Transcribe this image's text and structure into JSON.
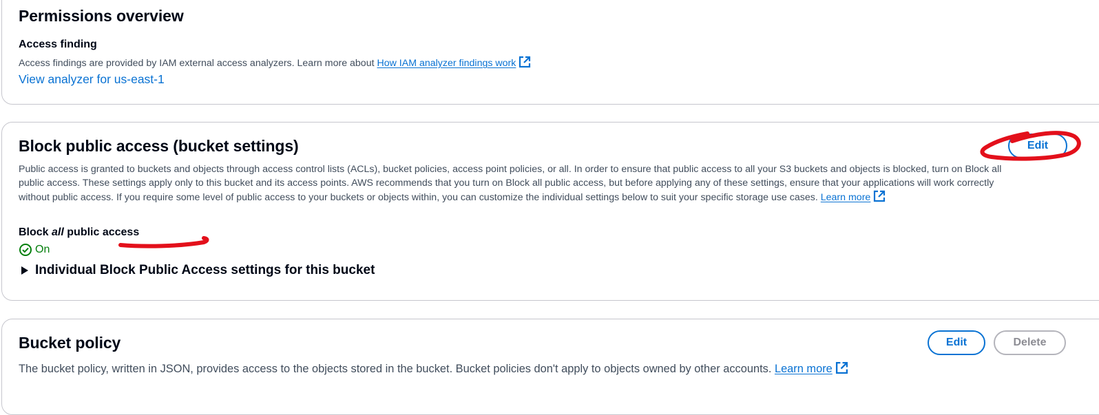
{
  "permissions_overview": {
    "title": "Permissions overview",
    "access_finding": {
      "heading": "Access finding",
      "description": "Access findings are provided by IAM external access analyzers. Learn more about",
      "help_link": "How IAM analyzer findings work",
      "analyzer_link": "View analyzer for us-east-1"
    }
  },
  "block_public_access": {
    "title": "Block public access (bucket settings)",
    "edit_label": "Edit",
    "description_lines": [
      "Public access is granted to buckets and objects through access control lists (ACLs), bucket policies, access point policies, or all. In order to ensure that public access to all your S3 buckets and objects is blocked, turn on Block all",
      "public access. These settings apply only to this bucket and its access points. AWS recommends that you turn on Block all public access, but before applying any of these settings, ensure that your applications will work correctly",
      "without public access. If you require some level of public access to your buckets or objects within, you can customize the individual settings below to suit your specific storage use cases."
    ],
    "learn_more": "Learn more",
    "setting_label_prefix": "Block",
    "setting_label_emphasis": "all",
    "setting_label_suffix": "public access",
    "status": "On",
    "expander_label": "Individual Block Public Access settings for this bucket"
  },
  "bucket_policy": {
    "title": "Bucket policy",
    "edit_label": "Edit",
    "delete_label": "Delete",
    "description": "The bucket policy, written in JSON, provides access to the objects stored in the bucket. Bucket policies don't apply to objects owned by other accounts.",
    "learn_more": "Learn more"
  },
  "colors": {
    "link": "#0972d3",
    "status_success": "#037f0c",
    "annotation": "#e3101b"
  },
  "icons": {
    "external_link": "external-link-icon",
    "status_ok": "check-circle-icon",
    "expander": "caret-right-icon"
  }
}
